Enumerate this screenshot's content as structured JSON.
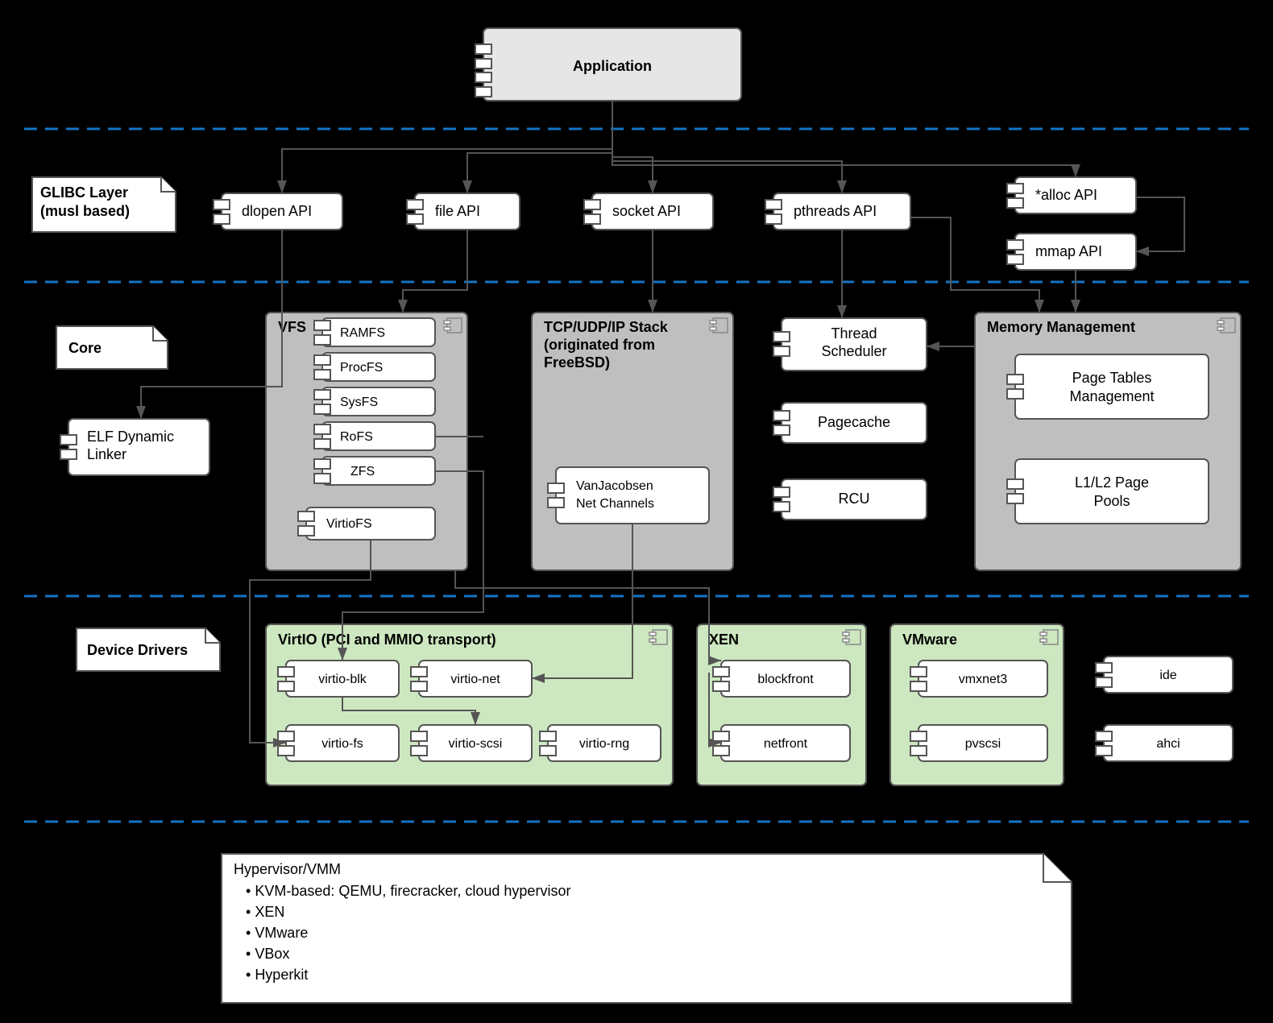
{
  "app": "Application",
  "layer_glibc": "GLIBC Layer\n(musl based)",
  "layer_core": "Core",
  "layer_drivers": "Device Drivers",
  "api": {
    "dlopen": "dlopen API",
    "file": "file API",
    "socket": "socket API",
    "pthreads": "pthreads API",
    "alloc": "*alloc API",
    "mmap": "mmap API"
  },
  "elf": "ELF Dynamic\nLinker",
  "vfs": {
    "title": "VFS",
    "ramfs": "RAMFS",
    "procfs": "ProcFS",
    "sysfs": "SysFS",
    "rofs": "RoFS",
    "zfs": "ZFS",
    "virtiofs": "VirtioFS"
  },
  "net": {
    "title": "TCP/UDP/IP Stack\n(originated from\nFreeBSD)",
    "van": "VanJacobsen\nNet Channels"
  },
  "threads": "Thread\nScheduler",
  "pagecache": "Pagecache",
  "rcu": "RCU",
  "mm": {
    "title": "Memory Management",
    "ptm": "Page Tables\nManagement",
    "pools": "L1/L2 Page\nPools"
  },
  "virtio": {
    "title": "VirtIO (PCI and MMIO transport)",
    "blk": "virtio-blk",
    "net": "virtio-net",
    "fs": "virtio-fs",
    "scsi": "virtio-scsi",
    "rng": "virtio-rng"
  },
  "xen": {
    "title": "XEN",
    "block": "blockfront",
    "net": "netfront"
  },
  "vmware": {
    "title": "VMware",
    "vmxnet": "vmxnet3",
    "pvscsi": "pvscsi"
  },
  "ide": "ide",
  "ahci": "ahci",
  "hv": {
    "title": "Hypervisor/VMM",
    "kvm": "KVM-based: QEMU, firecracker, cloud hypervisor",
    "xen": "XEN",
    "vmware": "VMware",
    "vbox": "VBox",
    "hk": "Hyperkit"
  }
}
